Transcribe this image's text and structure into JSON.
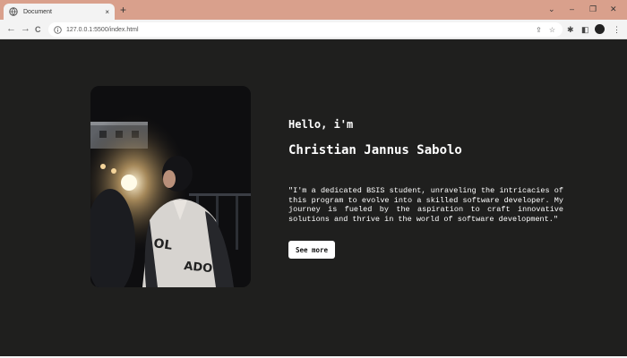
{
  "browser": {
    "tab_title": "Document",
    "tab_close": "×",
    "new_tab": "+",
    "url": "127.0.0.1:5500/index.html",
    "window_controls": {
      "dropdown": "⌄",
      "minimize": "–",
      "restore": "❐",
      "close": "✕"
    },
    "nav": {
      "back": "←",
      "forward": "→",
      "reload": "C"
    },
    "toolbar_icons": [
      "share-icon",
      "star-icon",
      "extensions-icon",
      "sidebar-icon",
      "profile-avatar",
      "menu-icon"
    ]
  },
  "hero": {
    "greeting": "Hello, i'm",
    "name": "Christian Jannus Sabolo",
    "bio": "\"I'm a dedicated BSIS student, unraveling the intricacies of this program to evolve into a skilled software developer. My journey is fueled by the aspiration to craft innovative solutions and thrive in the world of software development.\"",
    "button_label": "See more",
    "photo_icon": "profile-photo"
  },
  "colors": {
    "page_bg": "#1f1f1e",
    "tabbar_bg": "#d9a08c",
    "text": "#ffffff",
    "button_bg": "#ffffff"
  }
}
